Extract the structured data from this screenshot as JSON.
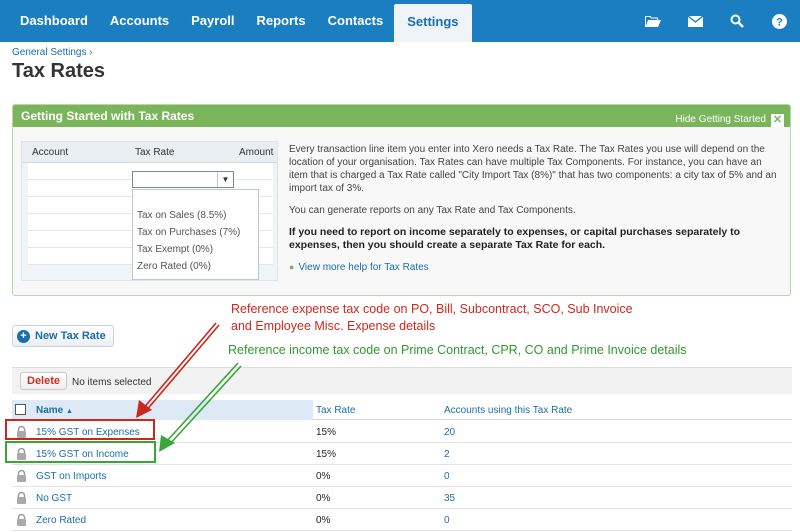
{
  "nav": {
    "tabs": [
      "Dashboard",
      "Accounts",
      "Payroll",
      "Reports",
      "Contacts",
      "Settings"
    ],
    "active_tab": "Settings",
    "icons": [
      "folder-icon",
      "mail-icon",
      "search-icon",
      "help-icon"
    ]
  },
  "breadcrumb": {
    "parent": "General Settings",
    "separator": "›"
  },
  "page": {
    "title": "Tax Rates"
  },
  "getting_started": {
    "title": "Getting Started with Tax Rates",
    "hide_label": "Hide Getting Started",
    "mock_table": {
      "columns": [
        "Account",
        "Tax Rate",
        "Amount"
      ],
      "options": [
        "Tax on Sales (8.5%)",
        "Tax on Purchases (7%)",
        "Tax Exempt (0%)",
        "Zero Rated (0%)"
      ]
    },
    "paragraph1": "Every transaction line item you enter into Xero needs a Tax Rate. The Tax Rates you use will depend on the location of your organisation. Tax Rates can have multiple Tax Components. For instance, you can have an item that is charged a Tax Rate called \"City Import Tax (8%)\" that has two components: a city tax of 5% and an import tax of 3%.",
    "paragraph2": "You can generate reports on any Tax Rate and Tax Components.",
    "paragraph3": "If you need to report on income separately to expenses, or capital purchases separately to expenses, then you should create a separate Tax Rate for each.",
    "help_link": "View more help for Tax Rates"
  },
  "actions": {
    "new_tax_rate": "New Tax Rate",
    "delete": "Delete",
    "selection_status": "No items selected"
  },
  "table": {
    "headers": {
      "name": "Name",
      "rate": "Tax Rate",
      "accounts": "Accounts using this Tax Rate"
    },
    "sort_indicator": "▲",
    "rows": [
      {
        "name": "15% GST on Expenses",
        "rate": "15%",
        "accounts": "20"
      },
      {
        "name": "15% GST on Income",
        "rate": "15%",
        "accounts": "2"
      },
      {
        "name": "GST on Imports",
        "rate": "0%",
        "accounts": "0"
      },
      {
        "name": "No GST",
        "rate": "0%",
        "accounts": "35"
      },
      {
        "name": "Zero Rated",
        "rate": "0%",
        "accounts": "0"
      }
    ]
  },
  "annotations": {
    "red": "Reference expense tax code on PO, Bill, Subcontract, SCO, Sub Invoice and Employee Misc. Expense details",
    "green": "Reference income tax code on Prime Contract, CPR, CO and Prime Invoice details",
    "red_color": "#d0281c",
    "green_color": "#2f9a2f"
  },
  "colors": {
    "nav_bg": "#1a7ec0",
    "panel_green": "#7ab55c",
    "link_blue": "#1a6fa8",
    "delete_red": "#c8311f"
  }
}
